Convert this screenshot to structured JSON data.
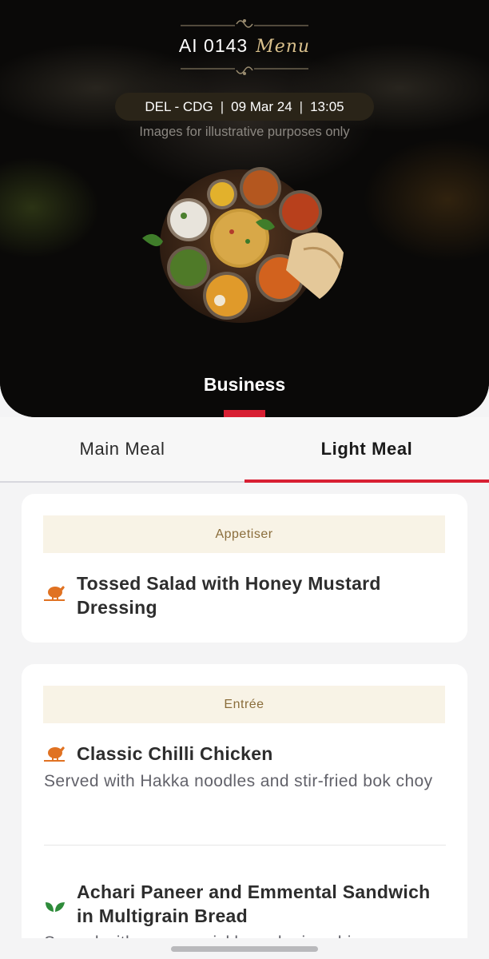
{
  "header": {
    "flight_number": "AI 0143",
    "menu_label": "Menu",
    "route": "DEL - CDG",
    "date": "09 Mar 24",
    "time": "13:05",
    "separator": "|",
    "disclaimer": "Images for illustrative purposes only",
    "cabin_class": "Business"
  },
  "tabs": [
    {
      "label": "Main Meal",
      "active": false
    },
    {
      "label": "Light Meal",
      "active": true
    }
  ],
  "sections": [
    {
      "title": "Appetiser",
      "dishes": [
        {
          "name": "Tossed Salad with Honey Mustard Dressing",
          "description": "",
          "diet": "non-vegetarian",
          "icon": "chicken-icon"
        }
      ]
    },
    {
      "title": "Entrée",
      "dishes": [
        {
          "name": "Classic Chilli Chicken",
          "description": "Served with Hakka noodles and stir-fried bok choy",
          "diet": "non-vegetarian",
          "icon": "chicken-icon"
        },
        {
          "name": "Achari Paneer and Emmental Sandwich in Multigrain Bread",
          "description": "Served with greens, pickle and crisp chips",
          "diet": "vegetarian",
          "icon": "leaf-icon"
        }
      ]
    }
  ],
  "colors": {
    "accent_red": "#d81f33",
    "section_header_bg": "#f8f3e6",
    "section_header_text": "#8a6d3b",
    "non_veg_icon": "#e07222",
    "veg_icon": "#2e8b3a",
    "menu_script": "#d9c08c"
  }
}
